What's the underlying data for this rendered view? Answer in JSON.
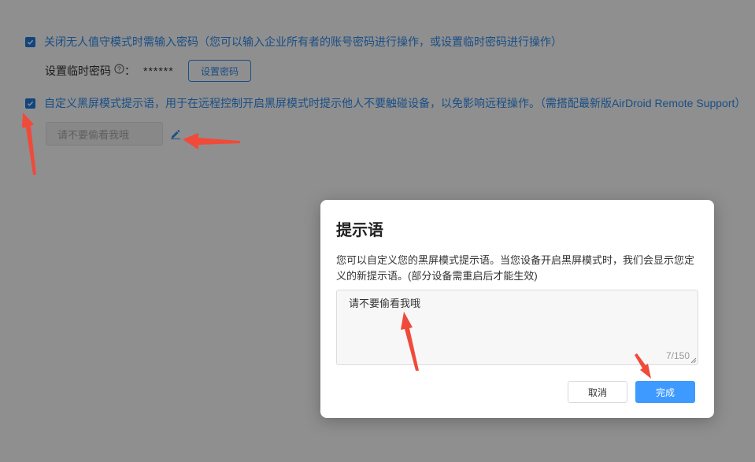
{
  "settings": {
    "unattended_password_label": "关闭无人值守模式时需输入密码（您可以输入企业所有者的账号密码进行操作，或设置临时密码进行操作）",
    "temp_password_label": "设置临时密码",
    "temp_password_colon": "：",
    "temp_password_value": "******",
    "set_password_button": "设置密码",
    "black_screen_label": "自定义黑屏模式提示语，用于在远程控制开启黑屏模式时提示他人不要触碰设备，以免影响远程操作。（需搭配最新版AirDroid Remote Support）",
    "prompt_value": "请不要偷看我哦"
  },
  "dialog": {
    "title": "提示语",
    "description": "您可以自定义您的黑屏模式提示语。当您设备开启黑屏模式时，我们会显示您定义的新提示语。(部分设备需重启后才能生效)",
    "textarea_value": "请不要偷看我哦",
    "counter": "7/150",
    "cancel_button": "取消",
    "done_button": "完成"
  },
  "colors": {
    "accent": "#2f8cef",
    "primary_button": "#3f9aff",
    "annotation_arrow": "#f04a3a"
  }
}
